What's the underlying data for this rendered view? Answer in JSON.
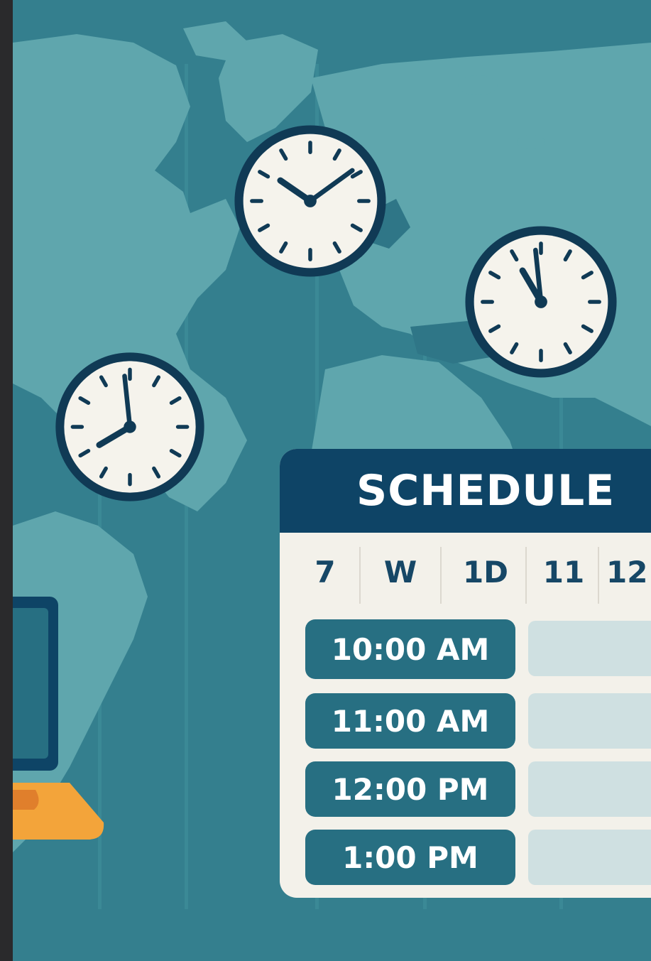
{
  "schedule": {
    "title": "SCHEDULE",
    "days": [
      "7",
      "W",
      "1D",
      "11",
      "12"
    ],
    "times": [
      "10:00 AM",
      "11:00 AM",
      "12:00 PM",
      "1:00 PM"
    ]
  },
  "clocks": [
    {
      "name": "clock-north-america",
      "hour": 10,
      "minute": 9
    },
    {
      "name": "clock-europe",
      "hour": 10,
      "minute": 59
    },
    {
      "name": "clock-americas",
      "hour": 7,
      "minute": 59
    }
  ],
  "colors": {
    "background": "#347f8e",
    "land": "#5fa6ad",
    "header": "#0e4466",
    "time_slot": "#276f82",
    "empty_cell": "#cfe0e1",
    "clock_face": "#f5f3ec",
    "clock_rim": "#103a55",
    "laptop_base": "#f3a43a"
  },
  "icons": [
    "world-map",
    "analog-clock-icon",
    "laptop-icon"
  ]
}
